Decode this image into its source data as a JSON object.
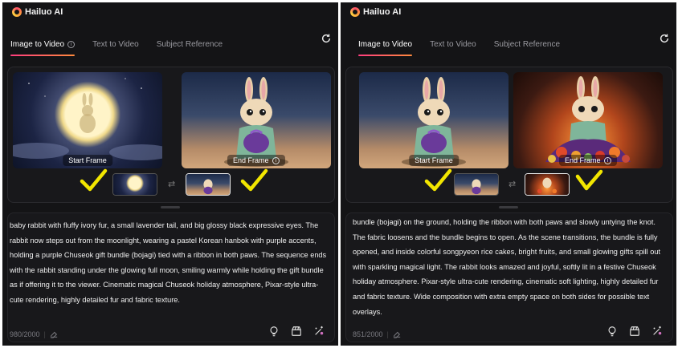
{
  "app": {
    "brand": "Hailuo AI"
  },
  "tabs": {
    "image_to_video": "Image to Video",
    "text_to_video": "Text to Video",
    "subject_reference": "Subject Reference"
  },
  "left": {
    "start_label": "Start Frame",
    "end_label": "End Frame",
    "prompt": "baby rabbit with fluffy ivory fur, a small lavender tail, and big glossy black expressive eyes. The rabbit now steps out from the moonlight, wearing a pastel Korean hanbok with purple accents, holding a purple Chuseok gift bundle (bojagi) tied with a ribbon in both paws. The sequence ends with the rabbit standing under the glowing full moon, smiling warmly while holding the gift bundle as if offering it to the viewer. Cinematic magical Chuseok holiday atmosphere, Pixar-style ultra-cute rendering, highly detailed fur and fabric texture.",
    "counter": "980/2000"
  },
  "right": {
    "start_label": "Start Frame",
    "end_label": "End Frame",
    "prompt": "bundle (bojagi) on the ground, holding the ribbon with both paws and slowly untying the knot. The fabric loosens and the bundle begins to open. As the scene transitions, the bundle is fully opened, and inside colorful songpyeon rice cakes, bright fruits, and small glowing gifts spill out with sparkling magical light. The rabbit looks amazed and joyful, softly lit in a festive Chuseok holiday atmosphere. Pixar-style ultra-cute rendering, cinematic soft lighting, highly detailed fur and fabric texture. Wide composition with extra empty space on both sides for possible text overlays.",
    "counter": "851/2000"
  },
  "icons": {
    "refresh": "refresh-icon",
    "info": "info-icon",
    "swap": "swap-icon",
    "eraser": "eraser-icon",
    "lightbulb": "lightbulb-icon",
    "camera": "camera-movie-icon",
    "magic": "magic-wand-icon",
    "check": "checkmark-annotation-icon"
  },
  "colors": {
    "background": "#141416",
    "accent_start": "#ff3d7f",
    "accent_end": "#ff8a3d",
    "check": "#f2e600"
  }
}
